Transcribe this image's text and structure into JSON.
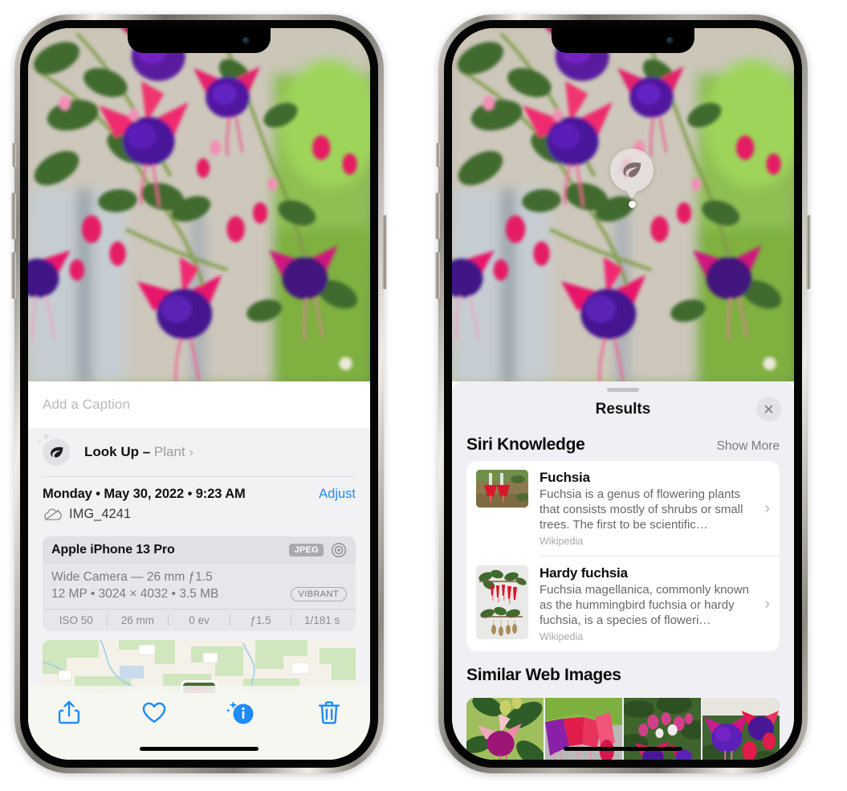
{
  "left_phone": {
    "caption_placeholder": "Add a Caption",
    "lookup": {
      "label": "Look Up –",
      "subject": "Plant",
      "chevron": "›",
      "icon": "leaf-icon"
    },
    "metadata": {
      "date_line": "Monday • May 30, 2022 • 9:23 AM",
      "adjust_label": "Adjust",
      "filename": "IMG_4241"
    },
    "camera_card": {
      "model": "Apple iPhone 13 Pro",
      "format_tag": "JPEG",
      "lens": "Wide Camera — 26 mm ƒ1.5",
      "specs": "12 MP • 3024 × 4032 • 3.5 MB",
      "style_tag": "VIBRANT",
      "exif": [
        "ISO 50",
        "26 mm",
        "0 ev",
        "ƒ1.5",
        "1/181 s"
      ]
    },
    "toolbar": {
      "share_label": "share-icon",
      "favorite_label": "heart-icon",
      "info_label": "info-icon",
      "delete_label": "trash-icon"
    }
  },
  "right_phone": {
    "badge": {
      "icon": "leaf-icon"
    },
    "results": {
      "title": "Results",
      "close_label": "×",
      "siri_knowledge": {
        "title": "Siri Knowledge",
        "show_more": "Show More",
        "items": [
          {
            "title": "Fuchsia",
            "description": "Fuchsia is a genus of flowering plants that consists mostly of shrubs or small trees. The first to be scientific…",
            "source": "Wikipedia",
            "chevron": "›"
          },
          {
            "title": "Hardy fuchsia",
            "description": "Fuchsia magellanica, commonly known as the hummingbird fuchsia or hardy fuchsia, is a species of floweri…",
            "source": "Wikipedia",
            "chevron": "›"
          }
        ]
      },
      "similar_web_images": {
        "title": "Similar Web Images",
        "count": 4
      }
    }
  },
  "colors": {
    "accent_blue": "#1d8bf8",
    "sheet_bg": "#f0f0f4",
    "card_bg": "#ffffff",
    "muted_text": "#7b7b80"
  }
}
